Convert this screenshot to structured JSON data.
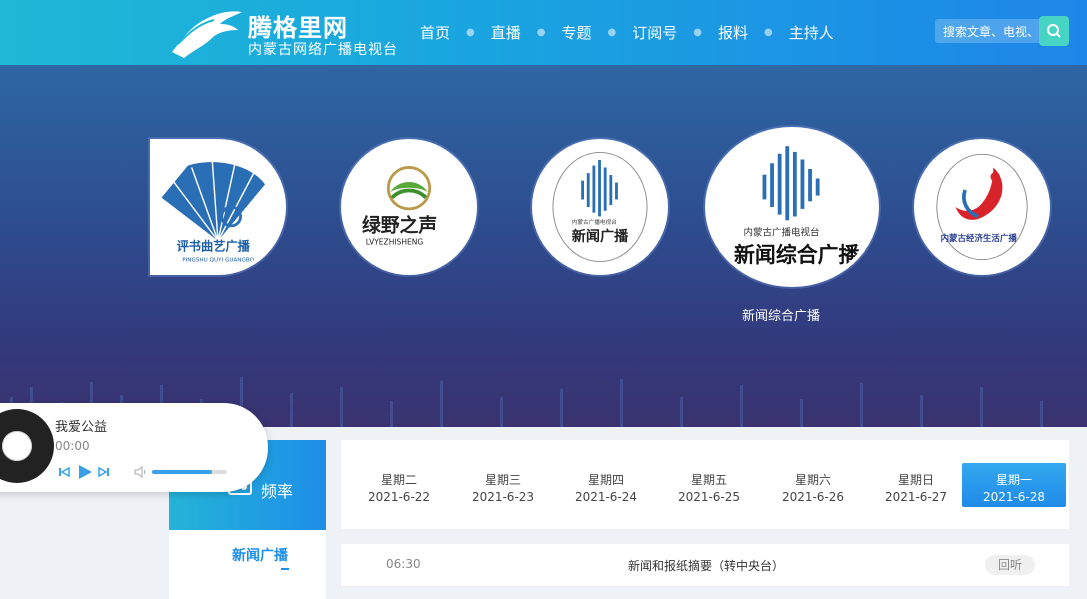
{
  "header": {
    "logo_title": "腾格里网",
    "logo_subtitle": "内蒙古网络广播电视台",
    "nav": [
      "首页",
      "直播",
      "专题",
      "订阅号",
      "报料",
      "主持人"
    ],
    "search_placeholder": "搜索文章、电视、..."
  },
  "stations": [
    {
      "id": "pingshu",
      "text_main": "评书曲艺广播",
      "text_sub": "PINGSHU QUYI GUANGBO"
    },
    {
      "id": "lvye",
      "text_main": "绿野之声",
      "text_sub": "LVYEZHISHENG"
    },
    {
      "id": "xinwen",
      "text_top": "内蒙古广播电视台",
      "text_main": "新闻广播"
    },
    {
      "id": "xinwenzonghe",
      "text_top": "内蒙古广播电视台",
      "text_main": "新闻综合广播",
      "label": "新闻综合广播"
    },
    {
      "id": "jingji",
      "text_main": "内蒙古经济生活广播"
    }
  ],
  "player": {
    "title": "我爱公益",
    "time": "00:00",
    "volume": 0.8
  },
  "freq": {
    "label": "频率",
    "active_item": "新闻广播"
  },
  "days": [
    {
      "weekday": "星期二",
      "date": "2021-6-22"
    },
    {
      "weekday": "星期三",
      "date": "2021-6-23"
    },
    {
      "weekday": "星期四",
      "date": "2021-6-24"
    },
    {
      "weekday": "星期五",
      "date": "2021-6-25"
    },
    {
      "weekday": "星期六",
      "date": "2021-6-26"
    },
    {
      "weekday": "星期日",
      "date": "2021-6-27"
    },
    {
      "weekday": "星期一",
      "date": "2021-6-28"
    }
  ],
  "program": {
    "time": "06:30",
    "name": "新闻和报纸摘要（转中央台）",
    "button": "回听"
  },
  "colors": {
    "accent": "#1d8ee8",
    "header_start": "#1fb8d6",
    "search_button": "#48d4c4"
  }
}
